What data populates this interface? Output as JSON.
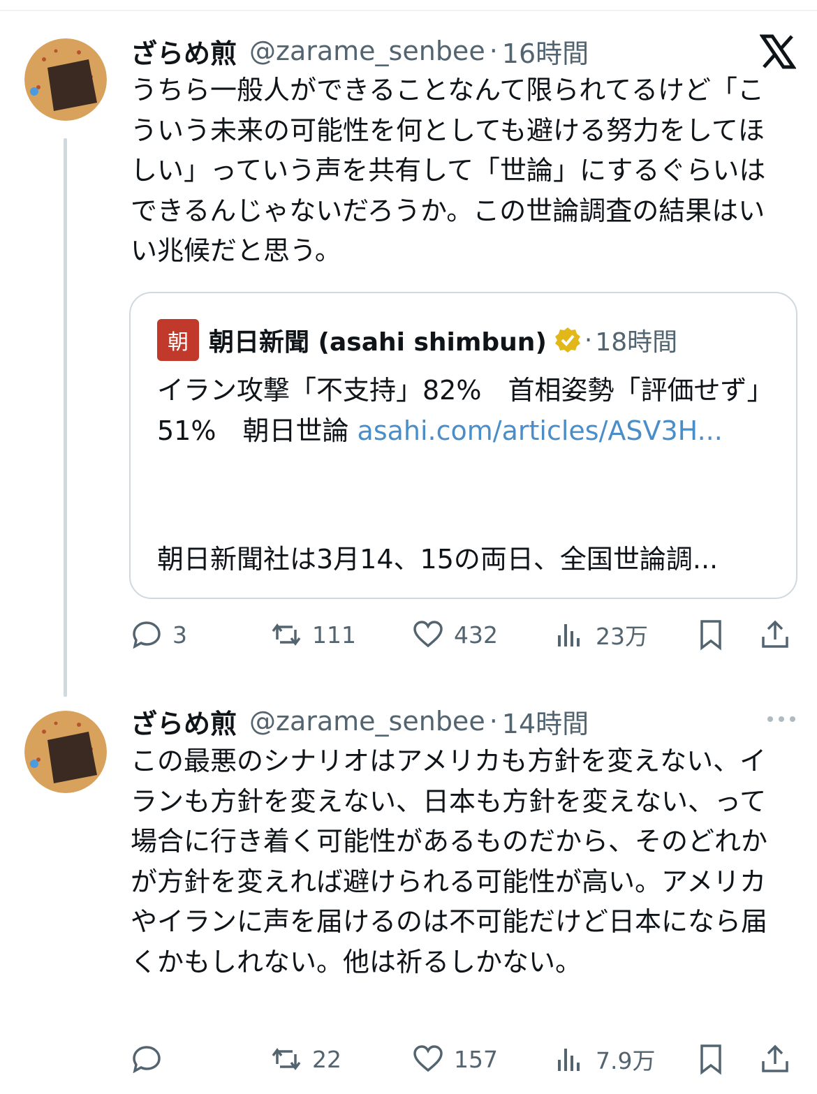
{
  "tweet1": {
    "display_name": "ざらめ煎",
    "handle": "@zarame_senbee",
    "dot": "·",
    "time": "16時間",
    "text": "うちら一般人ができることなんて限られてるけど「こういう未来の可能性を何としても避ける努力をしてほしい」っていう声を共有して「世論」にするぐらいはできるんじゃないだろうか。この世論調査の結果はいい兆候だと思う。",
    "quote": {
      "logo_text": "朝",
      "name": "朝日新聞 (asahi shimbun)",
      "dot": "·",
      "time": "18時間",
      "text": "イラン攻撃「不支持」82%　首相姿勢「評価せず」51%　朝日世論 ",
      "link": "asahi.com/articles/ASV3H...",
      "snippet": "朝日新聞社は3月14、15の両日、全国世論調..."
    },
    "actions": {
      "replies": "3",
      "reposts": "111",
      "likes": "432",
      "views": "23万"
    }
  },
  "tweet2": {
    "display_name": "ざらめ煎",
    "handle": "@zarame_senbee",
    "dot": "·",
    "time": "14時間",
    "text": "この最悪のシナリオはアメリカも方針を変えない、イランも方針を変えない、日本も方針を変えない、って場合に行き着く可能性があるものだから、そのどれかが方針を変えれば避けられる可能性が高い。アメリカやイランに声を届けるのは不可能だけど日本になら届くかもしれない。他は祈るしかない。",
    "actions": {
      "replies": "",
      "reposts": "22",
      "likes": "157",
      "views": "7.9万"
    }
  },
  "icons": {
    "brand": "x-logo-icon",
    "reply": "reply-icon",
    "repost": "repost-icon",
    "like": "heart-icon",
    "views": "views-icon",
    "bookmark": "bookmark-icon",
    "share": "share-icon",
    "more": "more-icon",
    "verified": "verified-badge-icon"
  },
  "colors": {
    "text": "#0f1419",
    "secondary": "#536471",
    "link": "#4a8ec9",
    "border": "#cfd9de",
    "verified_gold": "#e2b719",
    "asahi_red": "#c0392b"
  }
}
